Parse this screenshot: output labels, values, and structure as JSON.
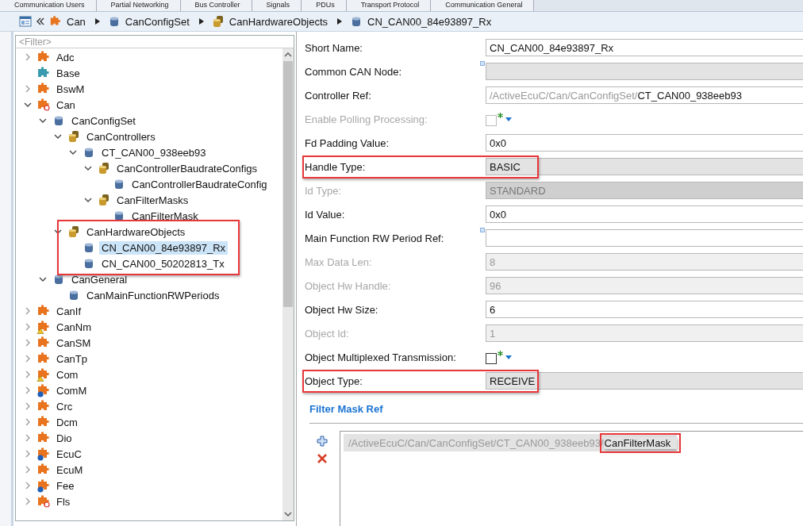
{
  "editor_tabs": [
    {
      "label": "Communication Users",
      "selected": false
    },
    {
      "label": "Partial Networking",
      "selected": false
    },
    {
      "label": "Bus Controller",
      "selected": false
    },
    {
      "label": "Signals",
      "selected": false
    },
    {
      "label": "PDUs",
      "selected": false
    },
    {
      "label": "Transport Protocol",
      "selected": false
    },
    {
      "label": "Communication General",
      "selected": false
    }
  ],
  "breadcrumb": [
    {
      "label": "Can",
      "kind": "module"
    },
    {
      "label": "CanConfigSet",
      "kind": "container"
    },
    {
      "label": "CanHardwareObjects",
      "kind": "list"
    },
    {
      "label": "CN_CAN00_84e93897_Rx",
      "kind": "container"
    }
  ],
  "tree": {
    "filter": {
      "placeholder": "<Filter>"
    },
    "items": [
      {
        "label": "Adc",
        "kind": "module",
        "expanded": false
      },
      {
        "label": "Base",
        "kind": "base"
      },
      {
        "label": "BswM",
        "kind": "module",
        "expanded": false
      },
      {
        "label": "Can",
        "kind": "module-error",
        "expanded": true,
        "children": [
          {
            "label": "CanConfigSet",
            "kind": "container",
            "expanded": true,
            "children": [
              {
                "label": "CanControllers",
                "kind": "list",
                "expanded": true,
                "children": [
                  {
                    "label": "CT_CAN00_938eeb93",
                    "kind": "container",
                    "expanded": true,
                    "children": [
                      {
                        "label": "CanControllerBaudrateConfigs",
                        "kind": "list",
                        "expanded": true,
                        "children": [
                          {
                            "label": "CanControllerBaudrateConfig",
                            "kind": "container"
                          }
                        ]
                      },
                      {
                        "label": "CanFilterMasks",
                        "kind": "list",
                        "expanded": true,
                        "children": [
                          {
                            "label": "CanFilterMask",
                            "kind": "container"
                          }
                        ]
                      }
                    ]
                  }
                ]
              },
              {
                "label": "CanHardwareObjects",
                "kind": "list",
                "expanded": true,
                "highlight": true,
                "children": [
                  {
                    "label": "CN_CAN00_84e93897_Rx",
                    "kind": "container",
                    "selected": true
                  },
                  {
                    "label": "CN_CAN00_50202813_Tx",
                    "kind": "container",
                    "selected": false
                  }
                ]
              }
            ]
          },
          {
            "label": "CanGeneral",
            "kind": "container",
            "expanded": true,
            "children": [
              {
                "label": "CanMainFunctionRWPeriods",
                "kind": "container"
              }
            ]
          }
        ]
      },
      {
        "label": "CanIf",
        "kind": "module",
        "expanded": false
      },
      {
        "label": "CanNm",
        "kind": "module-warning",
        "expanded": false
      },
      {
        "label": "CanSM",
        "kind": "module",
        "expanded": false
      },
      {
        "label": "CanTp",
        "kind": "module",
        "expanded": false
      },
      {
        "label": "Com",
        "kind": "module-warning",
        "expanded": false
      },
      {
        "label": "ComM",
        "kind": "module-info",
        "expanded": false
      },
      {
        "label": "Crc",
        "kind": "module",
        "expanded": false
      },
      {
        "label": "Dcm",
        "kind": "module",
        "expanded": false
      },
      {
        "label": "Dio",
        "kind": "module",
        "expanded": false
      },
      {
        "label": "EcuC",
        "kind": "module-info",
        "expanded": false
      },
      {
        "label": "EcuM",
        "kind": "module",
        "expanded": false
      },
      {
        "label": "Fee",
        "kind": "module-info",
        "expanded": false
      },
      {
        "label": "Fls",
        "kind": "module-error",
        "expanded": false
      }
    ]
  },
  "form": [
    {
      "label": "Short Name:",
      "kind": "text",
      "value": "CN_CAN00_84e93897_Rx",
      "disabled": false
    },
    {
      "label": "Common CAN Node:",
      "kind": "readonly",
      "disabled": false,
      "link": true
    },
    {
      "label": "Controller Ref:",
      "kind": "ref",
      "prefix": "/ActiveEcuC/Can/CanConfigSet/",
      "value": "CT_CAN00_938eeb93",
      "disabled": false
    },
    {
      "label": "Enable Polling Processing:",
      "kind": "checkbox",
      "checked": false,
      "disabled": true
    },
    {
      "label": "Fd Padding Value:",
      "kind": "text",
      "value": "0x0",
      "disabled": false
    },
    {
      "label": "Handle Type:",
      "kind": "readonly",
      "value": "BASIC",
      "disabled": false,
      "highlight": true
    },
    {
      "label": "Id Type:",
      "kind": "readonly",
      "value": "STANDARD",
      "disabled": true
    },
    {
      "label": "Id Value:",
      "kind": "text",
      "value": "0x0",
      "disabled": false
    },
    {
      "label": "Main Function RW Period Ref:",
      "kind": "text",
      "disabled": false,
      "link": true
    },
    {
      "label": "Max Data Len:",
      "kind": "text",
      "value": "8",
      "disabled": true
    },
    {
      "label": "Object Hw Handle:",
      "kind": "text",
      "value": "96",
      "disabled": true
    },
    {
      "label": "Object Hw Size:",
      "kind": "text",
      "value": "6",
      "disabled": false
    },
    {
      "label": "Object Id:",
      "kind": "text",
      "value": "1",
      "disabled": true
    },
    {
      "label": "Object Multiplexed Transmission:",
      "kind": "checkbox",
      "checked": false,
      "disabled": false
    },
    {
      "label": "Object Type:",
      "kind": "readonly",
      "value": "RECEIVE",
      "disabled": false,
      "highlight": true
    }
  ],
  "filter_mask_ref": {
    "title": "Filter Mask Ref",
    "items": [
      {
        "prefix": "/ActiveEcuC/Can/CanConfigSet/CT_CAN00_938eeb93/",
        "value": "CanFilterMask",
        "highlight": true
      }
    ]
  }
}
